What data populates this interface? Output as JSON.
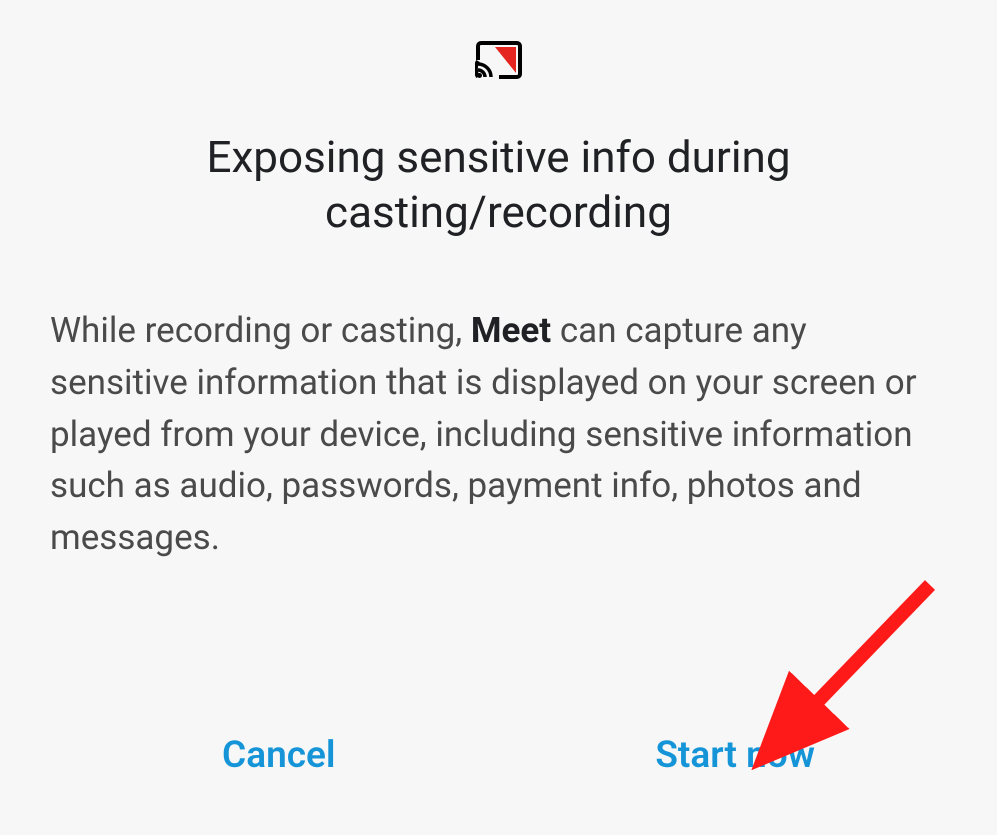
{
  "dialog": {
    "title": "Exposing sensitive info during casting/recording",
    "body_before": "While recording or casting, ",
    "body_bold": "Meet",
    "body_after": " can capture any sensitive information that is displayed on your screen or played from your device, including sensitive information such as audio, passwords, payment info, photos and messages.",
    "cancel_label": "Cancel",
    "confirm_label": "Start now"
  },
  "icons": {
    "cast": "casting-icon"
  },
  "colors": {
    "accent": "#1595d8",
    "alert": "#e52620",
    "text_primary": "#202124",
    "text_secondary": "#4a4a4a",
    "bg": "#f7f7f7"
  }
}
